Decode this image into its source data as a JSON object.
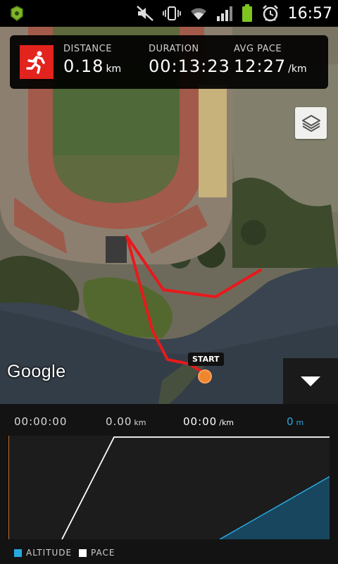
{
  "status_bar": {
    "time": "16:57",
    "icons": [
      "app-notification-icon",
      "mute-icon",
      "vibrate-icon",
      "wifi-icon",
      "signal-icon",
      "battery-icon",
      "alarm-icon"
    ]
  },
  "stats": {
    "distance_label": "DISTANCE",
    "distance_value": "0.18",
    "distance_unit": "km",
    "duration_label": "DURATION",
    "duration_value": "00:13:23",
    "pace_label": "AVG PACE",
    "pace_value": "12:27",
    "pace_unit": "/km"
  },
  "map": {
    "attribution": "Google",
    "start_label": "START",
    "route_color": "#e8191c",
    "start_color": "#f0862c"
  },
  "bottom_panel": {
    "time_value": "00:00:00",
    "distance_value": "0.00",
    "distance_unit": "km",
    "pace_value": "00:00",
    "pace_unit": "/km",
    "altitude_value": "0",
    "altitude_unit": "m",
    "altitude_color": "#29a8e0",
    "legend": {
      "altitude_label": "ALTITUDE",
      "pace_label": "PACE"
    }
  }
}
